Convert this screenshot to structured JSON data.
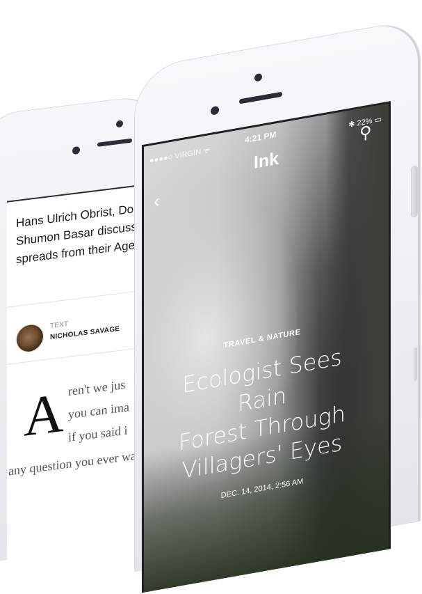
{
  "back_phone": {
    "headline_lines": [
      "Hans Ulrich Obrist, Doug",
      "Shumon Basar discuss tor",
      "spreads from their Age O"
    ],
    "author_kind": "TEXT",
    "author_name": "NICHOLAS SAVAGE",
    "dropcap": "A",
    "body_lines": [
      "ren't we jus",
      "you can ima",
      "if you said i",
      "any question you ever wa"
    ]
  },
  "front_phone": {
    "status": {
      "carrier": "●●●●○ VIRGIN ᯤ",
      "time": "4:21 PM",
      "battery": "✱ 22% ▭"
    },
    "app_title": "Ink",
    "back_glyph": "‹",
    "search_glyph": "⚲",
    "article": {
      "category": "TRAVEL & NATURE",
      "title_lines": [
        "Ecologist Sees Rain",
        "Forest Through",
        "Villagers' Eyes"
      ],
      "date": "DEC. 14, 2014, 2:56 AM"
    }
  }
}
